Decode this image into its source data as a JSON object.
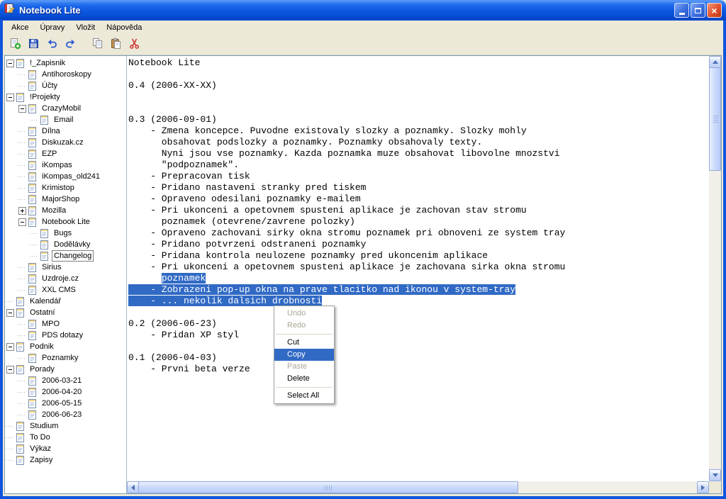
{
  "window": {
    "title": "Notebook Lite"
  },
  "menubar": [
    "Akce",
    "Úpravy",
    "Vložit",
    "Nápověda"
  ],
  "toolbar": [
    "new-note",
    "save",
    "undo",
    "redo",
    "copy",
    "paste",
    "cut"
  ],
  "tree": [
    {
      "label": "!_Zapisnik",
      "level": 0,
      "exp": "-"
    },
    {
      "label": "Antihoroskopy",
      "level": 1
    },
    {
      "label": "Účty",
      "level": 1
    },
    {
      "label": "!Projekty",
      "level": 0,
      "exp": "-"
    },
    {
      "label": "CrazyMobil",
      "level": 1,
      "exp": "-"
    },
    {
      "label": "Email",
      "level": 2
    },
    {
      "label": "Dílna",
      "level": 1
    },
    {
      "label": "Diskuzak.cz",
      "level": 1
    },
    {
      "label": "EZP",
      "level": 1
    },
    {
      "label": "iKompas",
      "level": 1
    },
    {
      "label": "iKompas_old241",
      "level": 1
    },
    {
      "label": "Krimistop",
      "level": 1
    },
    {
      "label": "MajorShop",
      "level": 1
    },
    {
      "label": "Mozilla",
      "level": 1,
      "exp": "+"
    },
    {
      "label": "Notebook Lite",
      "level": 1,
      "exp": "-"
    },
    {
      "label": "Bugs",
      "level": 2
    },
    {
      "label": "Dodělávky",
      "level": 2
    },
    {
      "label": "Changelog",
      "level": 2,
      "selected": true
    },
    {
      "label": "Sirius",
      "level": 1
    },
    {
      "label": "Uzdroje.cz",
      "level": 1
    },
    {
      "label": "XXL CMS",
      "level": 1
    },
    {
      "label": "Kalendář",
      "level": 0
    },
    {
      "label": "Ostatní",
      "level": 0,
      "exp": "-"
    },
    {
      "label": "MPO",
      "level": 1
    },
    {
      "label": "PDS dotazy",
      "level": 1
    },
    {
      "label": "Podnik",
      "level": 0,
      "exp": "-"
    },
    {
      "label": "Poznamky",
      "level": 1
    },
    {
      "label": "Porady",
      "level": 0,
      "exp": "-"
    },
    {
      "label": "2006-03-21",
      "level": 1
    },
    {
      "label": "2006-04-20",
      "level": 1
    },
    {
      "label": "2006-05-15",
      "level": 1
    },
    {
      "label": "2006-06-23",
      "level": 1
    },
    {
      "label": "Studium",
      "level": 0
    },
    {
      "label": "To Do",
      "level": 0
    },
    {
      "label": "Výkaz",
      "level": 0
    },
    {
      "label": "Zapisy",
      "level": 0
    }
  ],
  "editor": {
    "lines": [
      {
        "t": "Notebook Lite"
      },
      {
        "t": ""
      },
      {
        "t": "0.4 (2006-XX-XX)"
      },
      {
        "t": ""
      },
      {
        "t": ""
      },
      {
        "t": "0.3 (2006-09-01)"
      },
      {
        "t": "    - Zmena koncepce. Puvodne existovaly slozky a poznamky. Slozky mohly"
      },
      {
        "t": "      obsahovat podslozky a poznamky. Poznamky obsahovaly texty."
      },
      {
        "t": "      Nyni jsou vse poznamky. Kazda poznamka muze obsahovat libovolne mnozstvi"
      },
      {
        "t": "      \"podpoznamek\"."
      },
      {
        "t": "    - Prepracovan tisk"
      },
      {
        "t": "    - Pridano nastaveni stranky pred tiskem"
      },
      {
        "t": "    - Opraveno odesilani poznamky e-mailem"
      },
      {
        "t": "    - Pri ukonceni a opetovnem spusteni aplikace je zachovan stav stromu"
      },
      {
        "t": "      poznamek (otevrene/zavrene polozky)"
      },
      {
        "t": "    - Opraveno zachovani sirky okna stromu poznamek pri obnoveni ze system tray"
      },
      {
        "t": "    - Pridano potvrzeni odstraneni poznamky"
      },
      {
        "t": "    - Pridana kontrola neulozene poznamky pred ukoncenim aplikace"
      },
      {
        "t": "    - Pri ukonceni a opetovnem spusteni aplikace je zachovana sirka okna stromu"
      },
      {
        "pre": "      ",
        "sel": "poznamek"
      },
      {
        "sel": "    - Zobrazeni pop-up okna na prave tlacitko nad ikonou v system-tray"
      },
      {
        "sel": "    - ... nekolik dalsich drobnosti"
      },
      {
        "t": ""
      },
      {
        "t": "0.2 (2006-06-23)"
      },
      {
        "t": "    - Pridan XP styl"
      },
      {
        "t": ""
      },
      {
        "t": "0.1 (2006-04-03)"
      },
      {
        "t": "    - Prvni beta verze"
      }
    ]
  },
  "context_menu": {
    "items": [
      {
        "label": "Undo",
        "state": "disabled"
      },
      {
        "label": "Redo",
        "state": "disabled"
      },
      {
        "type": "separator"
      },
      {
        "label": "Cut"
      },
      {
        "label": "Copy",
        "state": "highlighted"
      },
      {
        "label": "Paste",
        "state": "disabled"
      },
      {
        "label": "Delete"
      },
      {
        "type": "separator"
      },
      {
        "label": "Select All"
      }
    ]
  },
  "colors": {
    "titlebar_blue": "#0b57e0",
    "window_border": "#0f55dd",
    "chrome_face": "#ECE9D8",
    "selection_blue": "#316AC5",
    "disabled_text": "#ACA899"
  }
}
